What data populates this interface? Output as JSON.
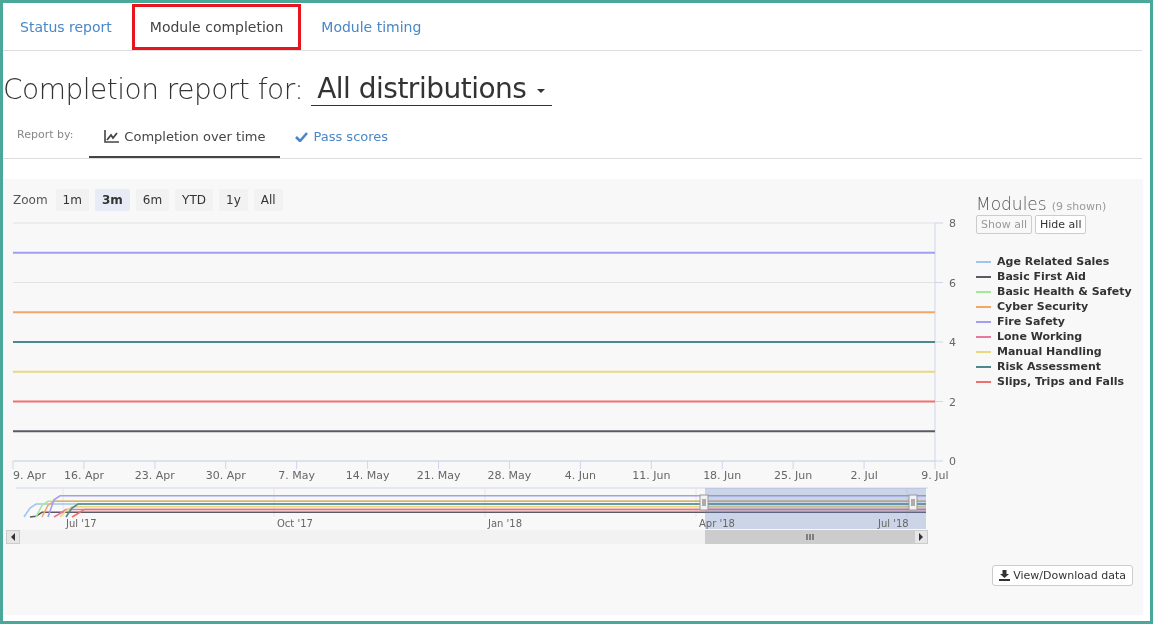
{
  "tabs": [
    {
      "label": "Status report",
      "selected": false
    },
    {
      "label": "Module completion",
      "selected": true
    },
    {
      "label": "Module timing",
      "selected": false
    }
  ],
  "heading": {
    "text": "Completion report for:",
    "dropdown": "All distributions"
  },
  "report_by": {
    "label": "Report by:",
    "options": [
      {
        "label": "Completion over time",
        "selected": true
      },
      {
        "label": "Pass scores",
        "selected": false
      }
    ]
  },
  "zoom": {
    "label": "Zoom",
    "buttons": [
      {
        "label": "1m",
        "selected": false
      },
      {
        "label": "3m",
        "selected": true
      },
      {
        "label": "6m",
        "selected": false
      },
      {
        "label": "YTD",
        "selected": false
      },
      {
        "label": "1y",
        "selected": false
      },
      {
        "label": "All",
        "selected": false
      }
    ]
  },
  "chart": {
    "chart_data": {
      "type": "line",
      "categories": [
        "9. Apr",
        "16. Apr",
        "23. Apr",
        "30. Apr",
        "7. May",
        "14. May",
        "21. May",
        "28. May",
        "4. Jun",
        "11. Jun",
        "18. Jun",
        "25. Jun",
        "2. Jul",
        "9. Jul"
      ],
      "ylim": [
        0,
        8
      ],
      "yticks": [
        0,
        2,
        4,
        6,
        8
      ],
      "series": [
        {
          "name": "Age Related Sales",
          "color": "#a0c4f0",
          "values": [
            null,
            null,
            null,
            null,
            null,
            null,
            null,
            null,
            null,
            null,
            null,
            null,
            null,
            null
          ]
        },
        {
          "name": "Basic First Aid",
          "color": "#5a5a64",
          "values": [
            1,
            1,
            1,
            1,
            1,
            1,
            1,
            1,
            1,
            1,
            1,
            1,
            1,
            1
          ]
        },
        {
          "name": "Basic Health & Safety",
          "color": "#a6e89a",
          "values": [
            null,
            null,
            null,
            null,
            null,
            null,
            null,
            null,
            null,
            null,
            null,
            null,
            null,
            null
          ]
        },
        {
          "name": "Cyber Security",
          "color": "#f0a868",
          "values": [
            5,
            5,
            5,
            5,
            5,
            5,
            5,
            5,
            5,
            5,
            5,
            5,
            5,
            5
          ]
        },
        {
          "name": "Fire Safety",
          "color": "#a0a0f0",
          "values": [
            7,
            7,
            7,
            7,
            7,
            7,
            7,
            7,
            7,
            7,
            7,
            7,
            7,
            7
          ]
        },
        {
          "name": "Lone Working",
          "color": "#e8789a",
          "values": [
            null,
            null,
            null,
            null,
            null,
            null,
            null,
            null,
            null,
            null,
            null,
            null,
            null,
            null
          ]
        },
        {
          "name": "Manual Handling",
          "color": "#e8d880",
          "values": [
            3,
            3,
            3,
            3,
            3,
            3,
            3,
            3,
            3,
            3,
            3,
            3,
            3,
            3
          ]
        },
        {
          "name": "Risk Assessment",
          "color": "#4a8a8c",
          "values": [
            4,
            4,
            4,
            4,
            4,
            4,
            4,
            4,
            4,
            4,
            4,
            4,
            4,
            4
          ]
        },
        {
          "name": "Slips, Trips and Falls",
          "color": "#f07070",
          "values": [
            2,
            2,
            2,
            2,
            2,
            2,
            2,
            2,
            2,
            2,
            2,
            2,
            2,
            2
          ]
        }
      ]
    },
    "navigator": {
      "labels": [
        "Jul '17",
        "Oct '17",
        "Jan '18",
        "Apr '18",
        "Jul '18"
      ]
    }
  },
  "legend": {
    "title": "Modules",
    "count": "(9 shown)",
    "buttons": [
      "Show all",
      "Hide all"
    ]
  },
  "download_button": "View/Download data"
}
